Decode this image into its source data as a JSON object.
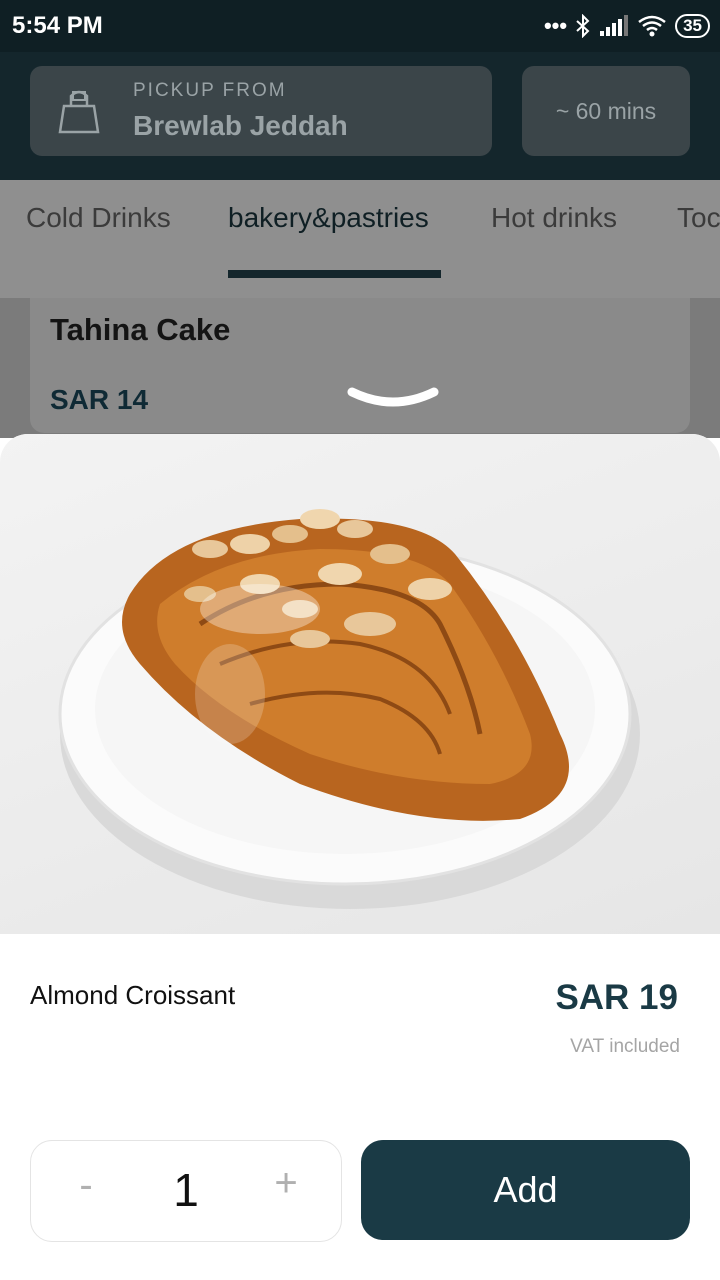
{
  "status_bar": {
    "time": "5:54 PM",
    "battery": "35"
  },
  "header": {
    "pickup_label": "PICKUP FROM",
    "store_name": "Brewlab Jeddah",
    "eta": "~ 60 mins"
  },
  "categories": {
    "tabs": [
      "Cold Drinks",
      "bakery&pastries",
      "Hot drinks",
      "Toc"
    ],
    "active": "bakery&pastries"
  },
  "list_item": {
    "name": "Tahina Cake",
    "price": "SAR 14"
  },
  "product": {
    "name": "Almond Croissant",
    "price": "SAR 19",
    "vat_note": "VAT included",
    "quantity": "1",
    "minus_label": "-",
    "plus_label": "+",
    "add_label": "Add"
  },
  "colors": {
    "header_bg": "#14262c",
    "accent": "#1a3a45",
    "card_bg": "#3b4549"
  },
  "icons": [
    "bag-icon",
    "bluetooth-icon",
    "signal-icon",
    "wifi-icon",
    "battery-icon",
    "chevron-down-icon"
  ]
}
